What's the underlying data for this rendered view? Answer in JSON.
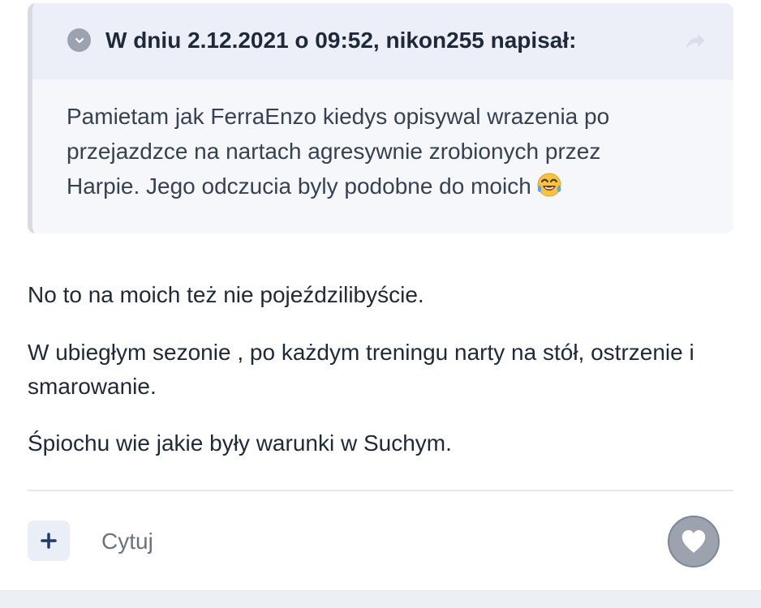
{
  "quote": {
    "citation": "W dniu 2.12.2021 o 09:52, nikon255 napisał:",
    "body": "Pamietam jak FerraEnzo kiedys opisywal wrazenia po przejazdzce na nartach agresywnie zrobionych przez Harpie. Jego odczucia byly podobne do moich",
    "emoji": "face-with-tears-of-joy-icon",
    "toggle_icon": "chevron-down-icon",
    "share_icon": "share-icon"
  },
  "post": {
    "paragraphs": [
      "No to na moich też  nie pojeździlibyście.",
      "W ubiegłym sezonie , po każdym treningu narty na stół, ostrzenie i smarowanie.",
      "Śpiochu wie jakie były warunki w Suchym."
    ]
  },
  "actions": {
    "add_icon": "plus-icon",
    "quote_label": "Cytuj",
    "like_icon": "heart-icon"
  },
  "colors": {
    "quote_background": "#f6f7fb",
    "quote_header_background": "#eceff7",
    "text": "#1f2937",
    "muted": "#6b7280",
    "accent": "#1f3b68",
    "icon_gray": "#9ca3af"
  }
}
